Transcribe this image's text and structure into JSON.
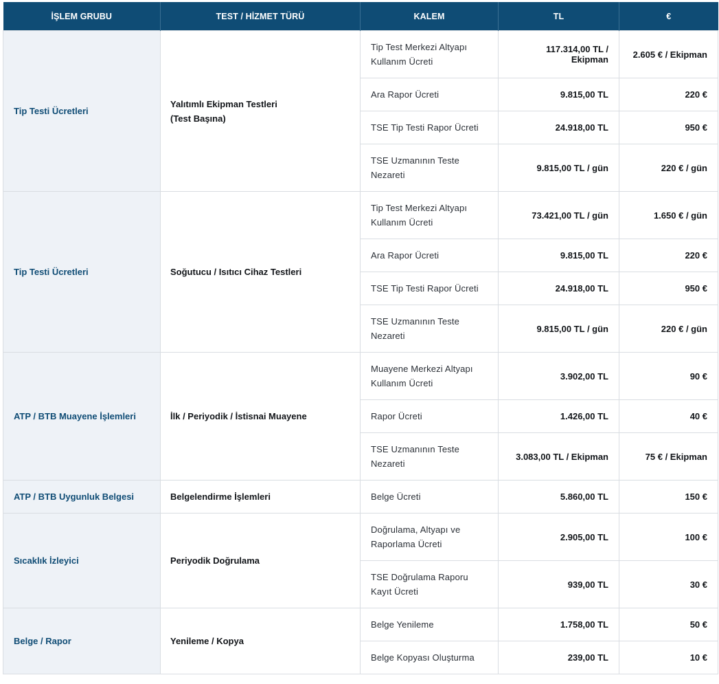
{
  "headers": {
    "group": "İŞLEM GRUBU",
    "service": "TEST / HİZMET TÜRÜ",
    "item": "KALEM",
    "tl": "TL",
    "eur": "€"
  },
  "sections": [
    {
      "group": "Tip Testi Ücretleri",
      "service_line1": "Yalıtımlı Ekipman Testleri",
      "service_line2": "(Test Başına)",
      "rows": [
        {
          "item": "Tip Test Merkezi Altyapı Kullanım Ücreti",
          "tl": "117.314,00 TL / Ekipman",
          "eur": "2.605 € / Ekipman"
        },
        {
          "item": "Ara Rapor Ücreti",
          "tl": "9.815,00 TL",
          "eur": "220 €"
        },
        {
          "item": "TSE Tip Testi Rapor Ücreti",
          "tl": "24.918,00 TL",
          "eur": "950 €"
        },
        {
          "item": "TSE Uzmanının Teste Nezareti",
          "tl": "9.815,00 TL / gün",
          "eur": "220 € / gün"
        }
      ]
    },
    {
      "group": "Tip Testi Ücretleri",
      "service_line1": "Soğutucu / Isıtıcı Cihaz Testleri",
      "service_line2": "",
      "rows": [
        {
          "item": "Tip Test Merkezi Altyapı Kullanım Ücreti",
          "tl": "73.421,00 TL / gün",
          "eur": "1.650 € / gün"
        },
        {
          "item": "Ara Rapor Ücreti",
          "tl": "9.815,00 TL",
          "eur": "220 €"
        },
        {
          "item": "TSE Tip Testi Rapor Ücreti",
          "tl": "24.918,00 TL",
          "eur": "950 €"
        },
        {
          "item": "TSE Uzmanının Teste Nezareti",
          "tl": "9.815,00 TL / gün",
          "eur": "220 € / gün"
        }
      ]
    },
    {
      "group": "ATP / BTB Muayene İşlemleri",
      "service_line1": "İlk / Periyodik / İstisnai Muayene",
      "service_line2": "",
      "rows": [
        {
          "item": "Muayene Merkezi Altyapı Kullanım Ücreti",
          "tl": "3.902,00 TL",
          "eur": "90 €"
        },
        {
          "item": "Rapor Ücreti",
          "tl": "1.426,00 TL",
          "eur": "40 €"
        },
        {
          "item": "TSE Uzmanının Teste Nezareti",
          "tl": "3.083,00 TL / Ekipman",
          "eur": "75 € / Ekipman"
        }
      ]
    },
    {
      "group": "ATP / BTB Uygunluk Belgesi",
      "service_line1": "Belgelendirme İşlemleri",
      "service_line2": "",
      "rows": [
        {
          "item": "Belge Ücreti",
          "tl": "5.860,00 TL",
          "eur": "150 €"
        }
      ]
    },
    {
      "group": "Sıcaklık İzleyici",
      "service_line1": "Periyodik Doğrulama",
      "service_line2": "",
      "rows": [
        {
          "item": "Doğrulama, Altyapı ve Raporlama Ücreti",
          "tl": "2.905,00 TL",
          "eur": "100 €"
        },
        {
          "item": "TSE Doğrulama Raporu Kayıt Ücreti",
          "tl": "939,00 TL",
          "eur": "30 €"
        }
      ]
    },
    {
      "group": "Belge / Rapor",
      "service_line1": "Yenileme / Kopya",
      "service_line2": "",
      "rows": [
        {
          "item": "Belge Yenileme",
          "tl": "1.758,00 TL",
          "eur": "50 €"
        },
        {
          "item": "Belge Kopyası Oluşturma",
          "tl": "239,00 TL",
          "eur": "10 €"
        }
      ]
    }
  ]
}
